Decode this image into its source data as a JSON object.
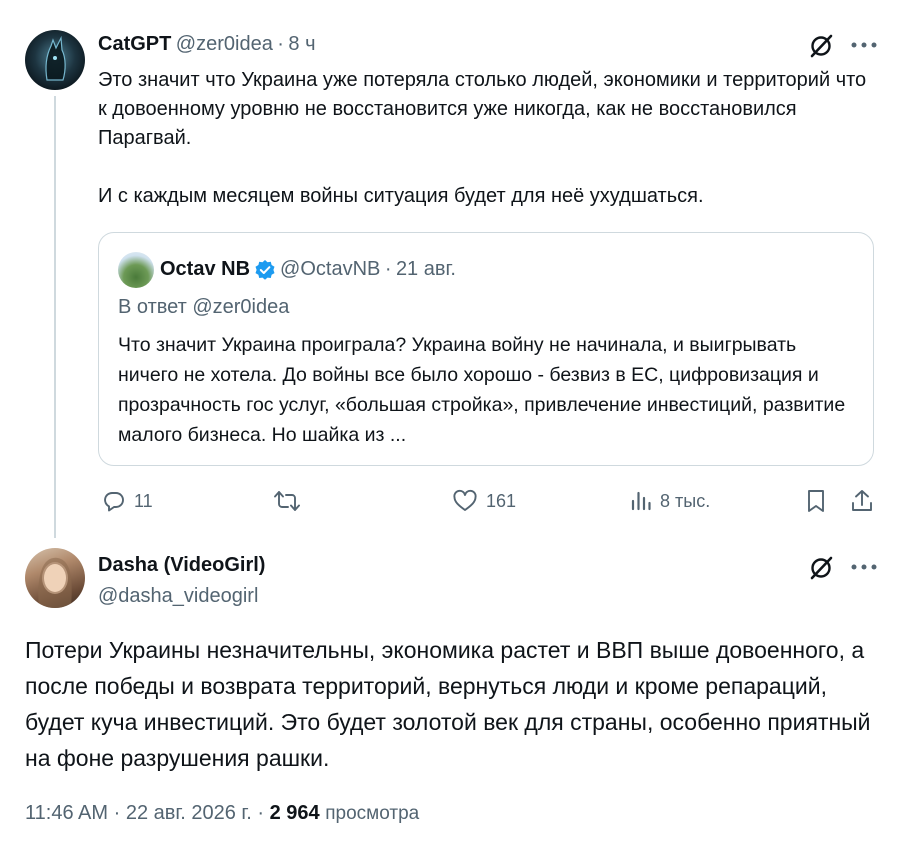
{
  "tweet1": {
    "author_name": "CatGPT",
    "handle": "@zer0idea",
    "separator": "·",
    "time": "8 ч",
    "paragraph1": "Это значит что Украина уже потеряла столько людей, экономики и территорий что к довоенному уровню не восстановится уже никогда, как не восстановился Парагвай.",
    "paragraph2": "И с каждым месяцем войны ситуация будет для неё ухудшаться.",
    "quote": {
      "author_name": "Octav NB",
      "handle": "@OctavNB",
      "separator": "·",
      "date": "21 авг.",
      "reply_to": "В ответ @zer0idea",
      "text": "Что значит Украина проиграла? Украина войну не начинала, и выигрывать ничего не хотела. До войны все было хорошо - безвиз в ЕС, цифровизация и прозрачность гос услуг, «большая стройка», привлечение инвестиций, развитие малого бизнеса. Но шайка из ..."
    },
    "actions": {
      "replies": "11",
      "retweets": "",
      "likes": "161",
      "views": "8 тыс."
    }
  },
  "tweet2": {
    "author_name": "Dasha (VideoGirl)",
    "handle": "@dasha_videogirl",
    "text": "Потери Украины незначительны, экономика растет и ВВП выше довоенного, а после победы и возврата территорий, вернуться люди и кроме репараций, будет куча инвестиций. Это будет золотой век для страны, особенно приятный на фоне разрушения рашки.",
    "time": "11:46 AM",
    "sep1": "·",
    "date": "22 авг. 2026 г.",
    "sep2": "·",
    "views_count": "2 964",
    "views_label": "просмотра"
  },
  "colors": {
    "text": "#0f1419",
    "muted": "#536471",
    "border": "#cfd9de",
    "verified": "#1d9bf0"
  },
  "icons": [
    "grok-icon",
    "more-icon",
    "reply-icon",
    "retweet-icon",
    "like-icon",
    "views-icon",
    "bookmark-icon",
    "share-icon",
    "verified-icon"
  ]
}
